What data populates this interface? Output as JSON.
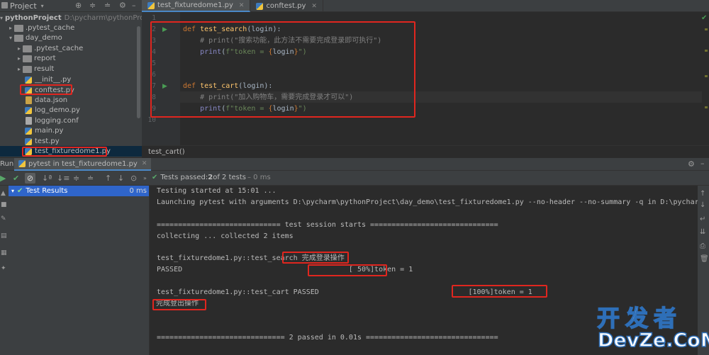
{
  "project_panel": {
    "title": "Project",
    "tree": [
      {
        "label": "pythonProject",
        "path": "D:\\pycharm\\pythonProject",
        "type": "folder",
        "expanded": true,
        "indent": 0,
        "bold": true
      },
      {
        "label": ".pytest_cache",
        "type": "folder",
        "expanded": false,
        "indent": 1
      },
      {
        "label": "day_demo",
        "type": "folder",
        "expanded": true,
        "indent": 1
      },
      {
        "label": ".pytest_cache",
        "type": "folder",
        "expanded": false,
        "indent": 2
      },
      {
        "label": "report",
        "type": "folder",
        "expanded": false,
        "indent": 2
      },
      {
        "label": "result",
        "type": "folder",
        "expanded": false,
        "indent": 2
      },
      {
        "label": "__init__.py",
        "type": "py",
        "indent": 3
      },
      {
        "label": "conftest.py",
        "type": "py",
        "indent": 3
      },
      {
        "label": "data.json",
        "type": "json",
        "indent": 3
      },
      {
        "label": "log_demo.py",
        "type": "py",
        "indent": 3
      },
      {
        "label": "logging.conf",
        "type": "txt",
        "indent": 3
      },
      {
        "label": "main.py",
        "type": "py",
        "indent": 3
      },
      {
        "label": "test.py",
        "type": "py",
        "indent": 3
      },
      {
        "label": "test_fixturedome1.py",
        "type": "py",
        "indent": 3,
        "selected": true
      }
    ]
  },
  "editor": {
    "tabs": [
      {
        "label": "test_fixturedome1.py",
        "active": true
      },
      {
        "label": "conftest.py",
        "active": false
      }
    ],
    "line_numbers": [
      "1",
      "2",
      "3",
      "4",
      "5",
      "6",
      "7",
      "8",
      "9",
      "10"
    ],
    "code": {
      "l2_def": "def ",
      "l2_fn": "test_search",
      "l2_rest": "(login):",
      "l3": "    # print(\"搜索功能，此方法不需要完成登录即可执行\")",
      "l4_bi": "print",
      "l4_open": "(",
      "l4_str": "f\"token = ",
      "l4_brace_open": "{",
      "l4_var": "login",
      "l4_brace_close": "}",
      "l4_end": "\")",
      "l7_def": "def ",
      "l7_fn": "test_cart",
      "l7_rest": "(login):",
      "l8": "    # print(\"加入购物车，需要完成登录才可以\")",
      "l9_bi": "print",
      "l9_open": "(",
      "l9_str": "f\"token = ",
      "l9_brace_open": "{",
      "l9_var": "login",
      "l9_brace_close": "}",
      "l9_end": "\")"
    },
    "breadcrumb": "test_cart()"
  },
  "run_panel": {
    "label": "Run:",
    "tab_label": "pytest in test_fixturedome1.py",
    "status": {
      "prefix": "Tests passed: ",
      "passed": "2",
      "suffix": " of 2 tests",
      "time": " – 0 ms"
    },
    "test_tree": {
      "root_label": "Test Results",
      "root_time": "0 ms"
    },
    "console_lines": [
      "Testing started at 15:01 ...",
      "Launching pytest with arguments D:\\pycharm\\pythonProject\\day_demo\\test_fixturedome1.py --no-header --no-summary -q in D:\\pycharm\\pyt",
      "============================= test session starts ==============================",
      "collecting ... collected 2 items",
      "test_fixturedome1.py::test_search 完成登录操作",
      "PASSED                                       [ 50%]token = 1",
      "test_fixturedome1.py::test_cart PASSED                                   [100%]token = 1",
      "完成登出操作",
      "============================== 2 passed in 0.01s ==============================="
    ]
  },
  "watermark": {
    "top": "开发者",
    "bottom": "DevZe.CoM"
  },
  "colors": {
    "accent": "#4a88c7",
    "annotation": "#e0261f",
    "selection": "#2f65ca",
    "pass": "#59a869"
  }
}
